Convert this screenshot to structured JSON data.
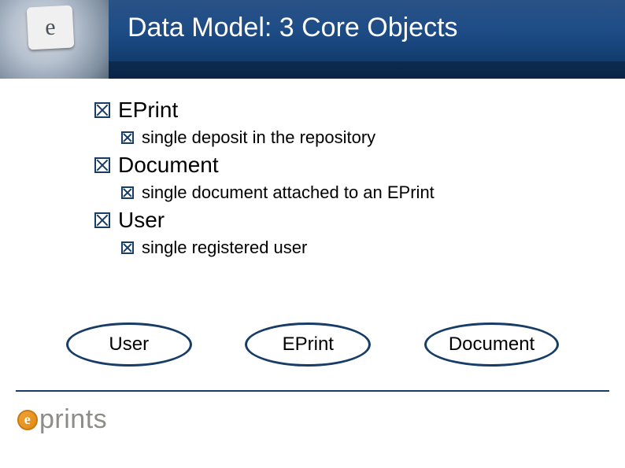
{
  "slide": {
    "title": "Data Model: 3 Core Objects"
  },
  "bullets": {
    "eprint": {
      "heading": "EPrint",
      "sub": "single deposit in the repository"
    },
    "document": {
      "heading": "Document",
      "sub": "single document attached to an EPrint"
    },
    "user": {
      "heading": "User",
      "sub": "single registered user"
    }
  },
  "diagram": {
    "node1": "User",
    "node2": "EPrint",
    "node3": "Document"
  },
  "branding": {
    "corner_glyph": "e",
    "logo_e": "e",
    "logo_text": "prints"
  }
}
